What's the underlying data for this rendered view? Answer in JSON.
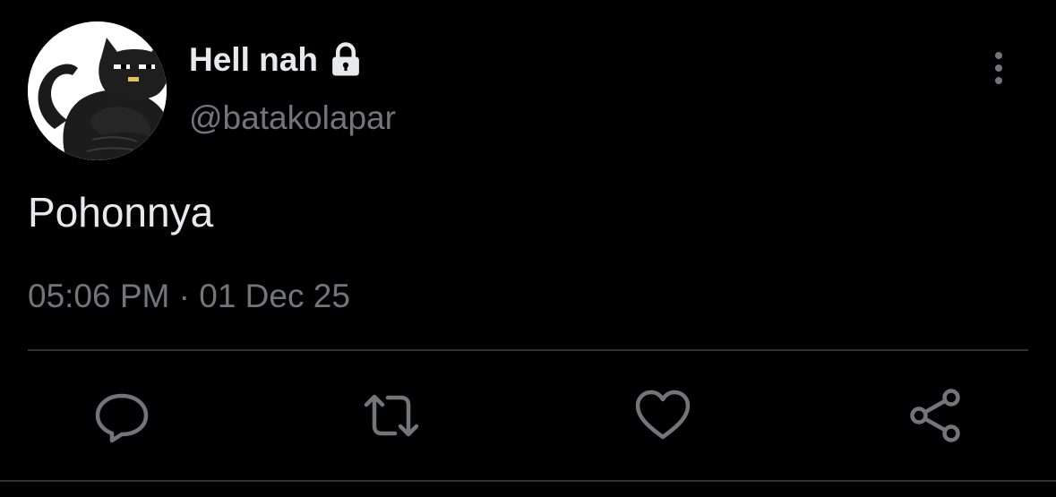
{
  "user": {
    "display_name": "Hell nah",
    "handle": "@batakolapar",
    "avatar_icon": "cat-avatar-icon",
    "protected_icon": "lock-icon"
  },
  "tweet": {
    "text": "Pohonnya",
    "timestamp": "05:06 PM · 01 Dec 25"
  },
  "menu": {
    "icon": "more-vertical-icon"
  },
  "actions": [
    {
      "name": "reply",
      "icon": "reply-icon"
    },
    {
      "name": "retweet",
      "icon": "retweet-icon"
    },
    {
      "name": "like",
      "icon": "heart-icon"
    },
    {
      "name": "share",
      "icon": "share-icon"
    }
  ],
  "colors": {
    "background": "#000000",
    "primary_text": "#e7e9ea",
    "secondary_text": "#71767b",
    "divider": "#2f3336"
  }
}
